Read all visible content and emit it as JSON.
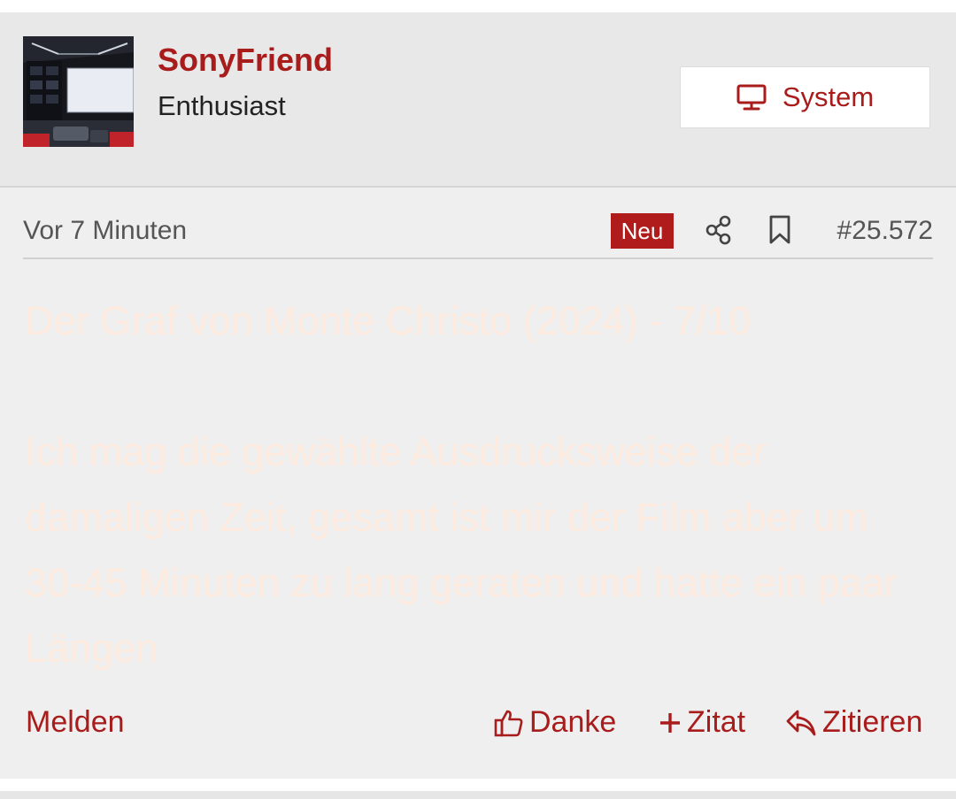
{
  "author": {
    "name": "SonyFriend",
    "title": "Enthusiast",
    "avatar_icon": "home-cinema-avatar"
  },
  "system_button": {
    "label": "System",
    "icon": "monitor-icon"
  },
  "meta": {
    "timestamp": "Vor 7 Minuten",
    "badge": "Neu",
    "post_number": "#25.572"
  },
  "content": {
    "heading": "Der Graf von Monte Christo (2024) - 7/10",
    "body": "Ich mag die gewählte Ausdrucksweise der damaligen Zeit, gesamt ist mir der Film aber um 30-45 Minuten zu lang geraten und hatte ein paar Längen"
  },
  "actions": {
    "report": "Melden",
    "like": "Danke",
    "quote_add": "Zitat",
    "reply": "Zitieren"
  },
  "colors": {
    "accent": "#a81c1c",
    "badge": "#b01c1c",
    "header_bg": "#e8e8e8",
    "post_bg": "#efefef"
  }
}
